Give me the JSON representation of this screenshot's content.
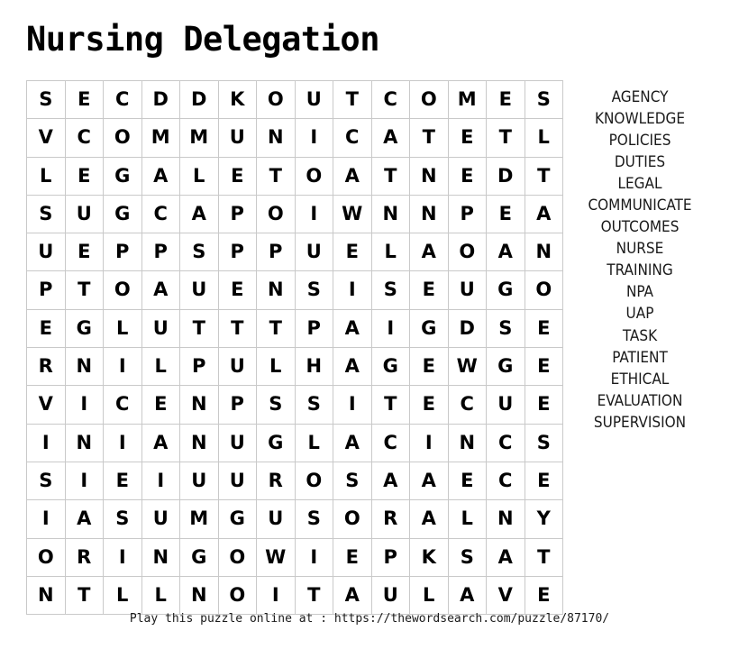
{
  "title": "Nursing Delegation",
  "grid": {
    "rows": 14,
    "cols": 14,
    "letters": [
      [
        "S",
        "E",
        "C",
        "D",
        "D",
        "K",
        "O",
        "U",
        "T",
        "C",
        "O",
        "M",
        "E",
        "S"
      ],
      [
        "V",
        "C",
        "O",
        "M",
        "M",
        "U",
        "N",
        "I",
        "C",
        "A",
        "T",
        "E",
        "T",
        "L"
      ],
      [
        "L",
        "E",
        "G",
        "A",
        "L",
        "E",
        "T",
        "O",
        "A",
        "T",
        "N",
        "E",
        "D",
        "T"
      ],
      [
        "S",
        "U",
        "G",
        "C",
        "A",
        "P",
        "O",
        "I",
        "W",
        "N",
        "N",
        "P",
        "E",
        "A"
      ],
      [
        "U",
        "E",
        "P",
        "P",
        "S",
        "P",
        "P",
        "U",
        "E",
        "L",
        "A",
        "O",
        "A",
        "N"
      ],
      [
        "P",
        "T",
        "O",
        "A",
        "U",
        "E",
        "N",
        "S",
        "I",
        "S",
        "E",
        "U",
        "G",
        "O"
      ],
      [
        "E",
        "G",
        "L",
        "U",
        "T",
        "T",
        "T",
        "P",
        "A",
        "I",
        "G",
        "D",
        "S",
        "E"
      ],
      [
        "R",
        "N",
        "I",
        "L",
        "P",
        "U",
        "L",
        "H",
        "A",
        "G",
        "E",
        "W",
        "G",
        "E"
      ],
      [
        "V",
        "I",
        "C",
        "E",
        "N",
        "P",
        "S",
        "S",
        "I",
        "T",
        "E",
        "C",
        "U",
        "E"
      ],
      [
        "I",
        "N",
        "I",
        "A",
        "N",
        "U",
        "G",
        "L",
        "A",
        "C",
        "I",
        "N",
        "C",
        "S"
      ],
      [
        "S",
        "I",
        "E",
        "I",
        "U",
        "U",
        "R",
        "O",
        "S",
        "A",
        "A",
        "E",
        "C",
        "E"
      ],
      [
        "I",
        "A",
        "S",
        "U",
        "M",
        "G",
        "U",
        "S",
        "O",
        "R",
        "A",
        "L",
        "N",
        "Y"
      ],
      [
        "O",
        "R",
        "I",
        "N",
        "G",
        "O",
        "W",
        "I",
        "E",
        "P",
        "K",
        "S",
        "A",
        "T"
      ],
      [
        "N",
        "T",
        "L",
        "L",
        "N",
        "O",
        "I",
        "T",
        "A",
        "U",
        "L",
        "A",
        "V",
        "E"
      ]
    ]
  },
  "word_list": [
    "AGENCY",
    "KNOWLEDGE",
    "POLICIES",
    "DUTIES",
    "LEGAL",
    "COMMUNICATE",
    "OUTCOMES",
    "NURSE",
    "TRAINING",
    "NPA",
    "UAP",
    "TASK",
    "PATIENT",
    "ETHICAL",
    "EVALUATION",
    "SUPERVISION"
  ],
  "footer": "Play this puzzle online at : https://thewordsearch.com/puzzle/87170/",
  "colors": {
    "text": "#000000",
    "grid_line": "#c9c9c9",
    "background": "#ffffff"
  }
}
